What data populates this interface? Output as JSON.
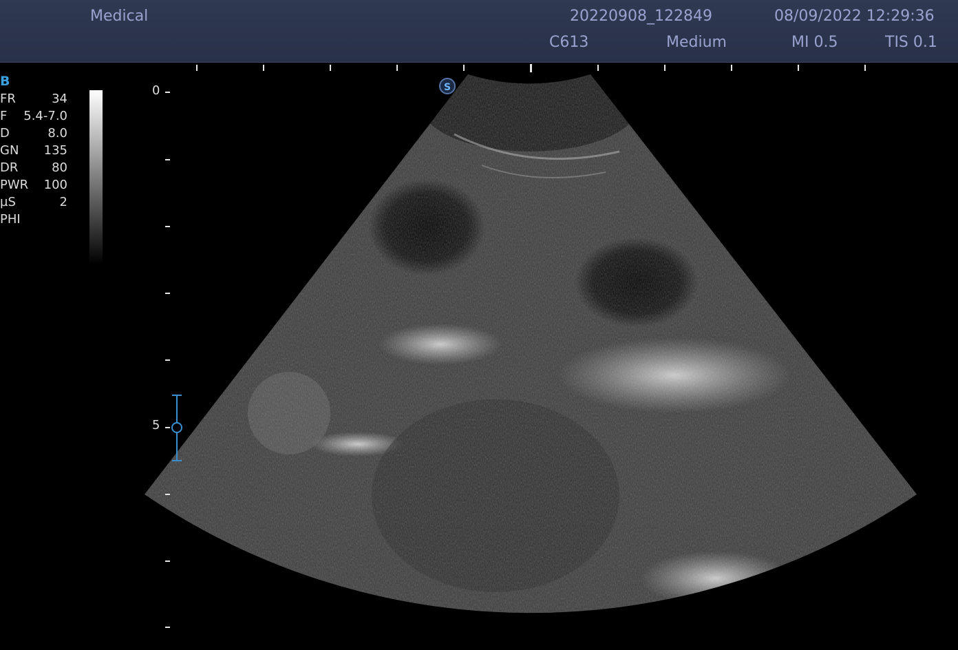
{
  "header": {
    "institution": "Medical",
    "study_id": "20220908_122849",
    "datetime": "08/09/2022 12:29:36",
    "probe": "C613",
    "preset": "Medium",
    "mi": "MI 0.5",
    "tis": "TIS 0.1"
  },
  "params": {
    "mode": "B",
    "rows": [
      {
        "k": "FR",
        "v": "34"
      },
      {
        "k": "F",
        "v": "5.4-7.0"
      },
      {
        "k": "D",
        "v": "8.0"
      },
      {
        "k": "GN",
        "v": "135"
      },
      {
        "k": "DR",
        "v": "80"
      },
      {
        "k": "PWR",
        "v": "100"
      },
      {
        "k": "µS",
        "v": "2"
      },
      {
        "k": "PHI",
        "v": ""
      }
    ]
  },
  "depth_scale": {
    "label_0": "0",
    "label_5": "5"
  },
  "orientation_marker": "S",
  "icons": {
    "focus": "focus-marker-icon",
    "orientation": "orientation-s-icon"
  },
  "colors": {
    "header_bg": "#2b344b",
    "header_text": "#9aa3cf",
    "mode_accent": "#3aa0e0",
    "focus_marker": "#3a8fd0"
  }
}
